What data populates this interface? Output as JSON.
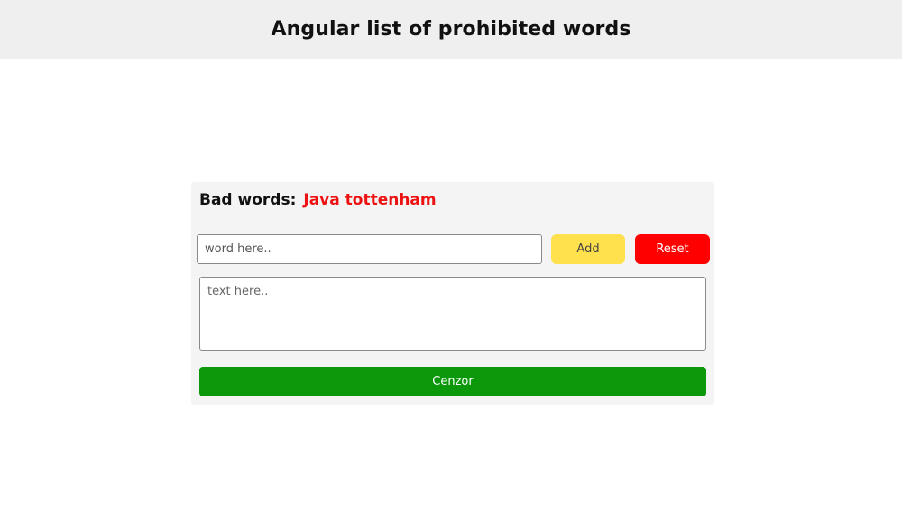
{
  "header": {
    "title": "Angular list of prohibited words"
  },
  "panel": {
    "bad_words_label": "Bad words:",
    "bad_words_value": "Java tottenham",
    "word_input": {
      "value": "",
      "placeholder": "word here.."
    },
    "add_label": "Add",
    "reset_label": "Reset",
    "text_area": {
      "value": "",
      "placeholder": "text here.."
    },
    "cenzor_label": "Cenzor"
  },
  "colors": {
    "header_bg": "#efefef",
    "panel_bg": "#f4f4f4",
    "bad_words_accent": "#ee1111",
    "add_button": "#ffe04d",
    "reset_button": "#ff0000",
    "cenzor_button": "#0b980b"
  }
}
